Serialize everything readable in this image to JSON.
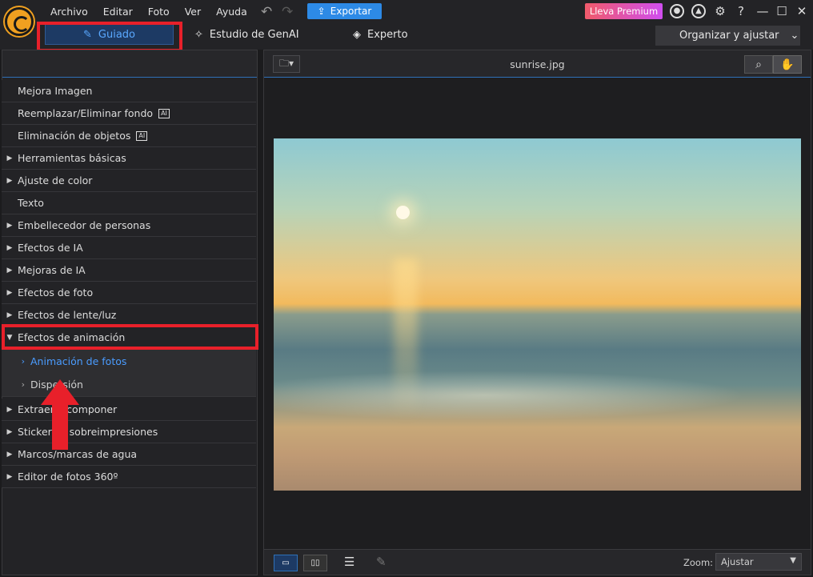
{
  "menu": [
    "Archivo",
    "Editar",
    "Foto",
    "Ver",
    "Ayuda"
  ],
  "export_label": "Exportar",
  "premium_label": "Lleva Premium",
  "tabs": {
    "guiado": "Guiado",
    "genai": "Estudio de GenAI",
    "experto": "Experto"
  },
  "organize_label": "Organizar y ajustar",
  "panel_items": [
    "Mejora Imagen",
    "Reemplazar/Eliminar fondo",
    "Eliminación de objetos",
    "Herramientas básicas",
    "Ajuste de color",
    "Texto",
    "Embellecedor de personas",
    "Efectos de IA",
    "Mejoras de IA",
    "Efectos de foto",
    "Efectos de lente/luz",
    "Efectos de animación"
  ],
  "sub_items": [
    "Animación de fotos",
    "Dispersión"
  ],
  "panel_items_after": [
    "Extraer y componer",
    "Stickers y sobreimpresiones",
    "Marcos/marcas de agua",
    "Editor de fotos 360º"
  ],
  "ai_badge": "AI",
  "filename": "sunrise.jpg",
  "zoom": {
    "label": "Zoom:",
    "value": "Ajustar"
  },
  "icons": [
    "logo",
    "undo-icon",
    "redo-icon",
    "upload-icon",
    "user-icon",
    "bell-icon",
    "gear-icon",
    "help-icon",
    "minimize-icon",
    "maximize-icon",
    "close-icon",
    "folder-icon",
    "magnifier-icon",
    "hand-icon"
  ]
}
